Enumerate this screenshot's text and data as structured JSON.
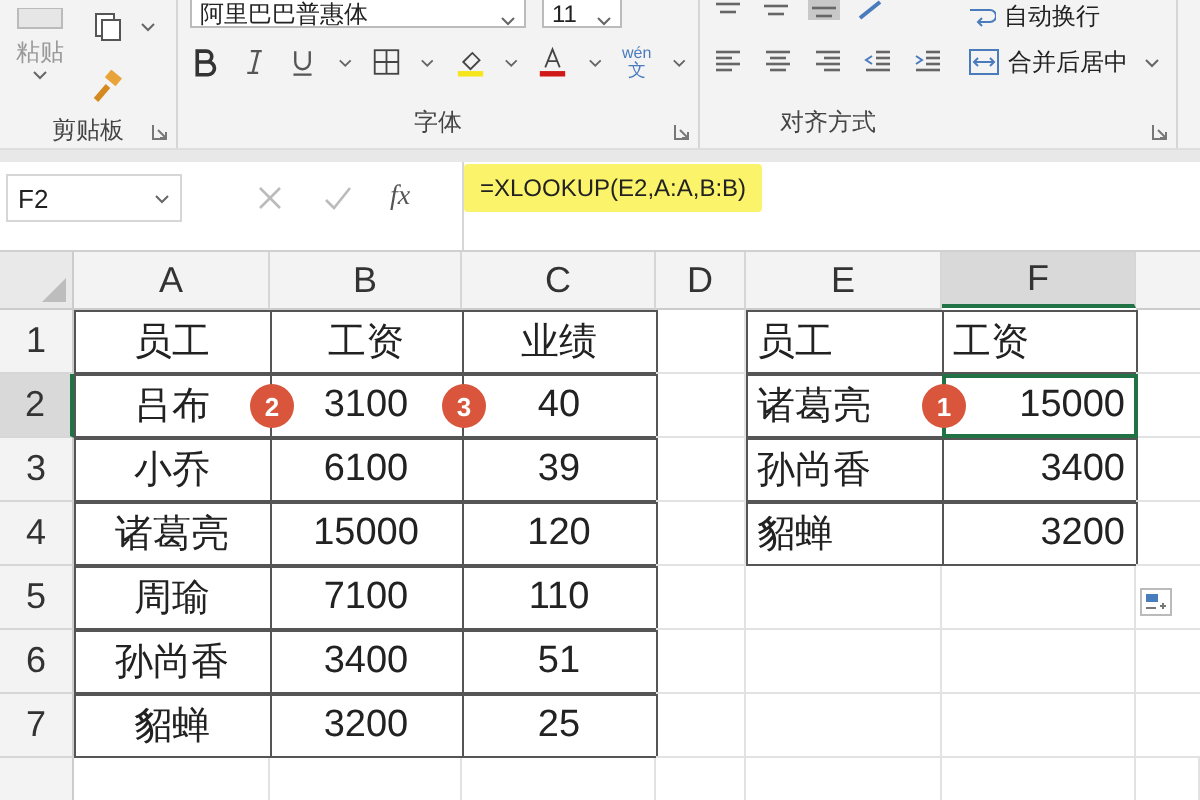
{
  "ribbon": {
    "font_name": "阿里巴巴普惠体",
    "font_size": "11",
    "paste_label": "粘贴",
    "phonetic_top": "wén",
    "phonetic_bottom": "文",
    "wrap_text": "自动换行",
    "merge_center": "合并后居中",
    "groups": [
      "剪贴板",
      "字体",
      "对齐方式"
    ]
  },
  "formula_bar": {
    "name_box": "F2",
    "fx_label": "fx",
    "formula": "=XLOOKUP(E2,A:A,B:B)",
    "highlighted": true
  },
  "sheet": {
    "columns": [
      {
        "label": "A",
        "selected": false
      },
      {
        "label": "B",
        "selected": false
      },
      {
        "label": "C",
        "selected": false
      },
      {
        "label": "D",
        "selected": false
      },
      {
        "label": "E",
        "selected": false
      },
      {
        "label": "F",
        "selected": true
      }
    ],
    "rows": [
      {
        "label": "1",
        "selected": false,
        "left": [
          {
            "text": "员工"
          },
          {
            "text": "工资"
          },
          {
            "text": "业绩"
          }
        ],
        "right": [
          {
            "text": "员工"
          },
          {
            "text": "工资"
          }
        ]
      },
      {
        "label": "2",
        "selected": true,
        "left": [
          {
            "text": "吕布",
            "badge": "2"
          },
          {
            "text": "3100",
            "badge": "3"
          },
          {
            "text": "40"
          }
        ],
        "right": [
          {
            "text": "诸葛亮",
            "badge": "1"
          },
          {
            "text": "15000"
          }
        ]
      },
      {
        "label": "3",
        "selected": false,
        "left": [
          {
            "text": "小乔"
          },
          {
            "text": "6100"
          },
          {
            "text": "39"
          }
        ],
        "right": [
          {
            "text": "孙尚香"
          },
          {
            "text": "3400"
          }
        ]
      },
      {
        "label": "4",
        "selected": false,
        "left": [
          {
            "text": "诸葛亮"
          },
          {
            "text": "15000"
          },
          {
            "text": "120"
          }
        ],
        "right": [
          {
            "text": "貂蝉"
          },
          {
            "text": "3200"
          }
        ]
      },
      {
        "label": "5",
        "selected": false,
        "left": [
          {
            "text": "周瑜"
          },
          {
            "text": "7100"
          },
          {
            "text": "110"
          }
        ]
      },
      {
        "label": "6",
        "selected": false,
        "left": [
          {
            "text": "孙尚香"
          },
          {
            "text": "3400"
          },
          {
            "text": "51"
          }
        ]
      },
      {
        "label": "7",
        "selected": false,
        "left": [
          {
            "text": "貂蝉"
          },
          {
            "text": "3200"
          },
          {
            "text": "25"
          }
        ]
      }
    ]
  }
}
